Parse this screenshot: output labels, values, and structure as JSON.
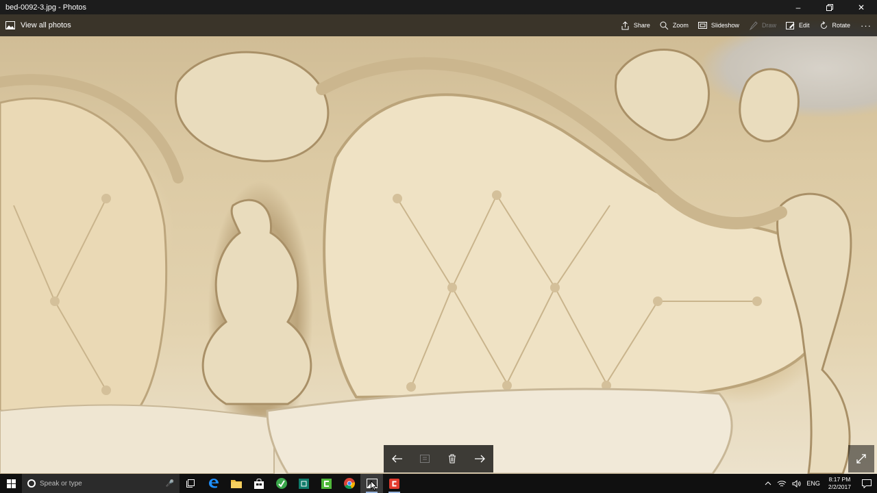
{
  "window": {
    "title": "bed-0092-3.jpg - Photos",
    "minimize_icon": "minimize-icon",
    "maximize_icon": "restore-icon",
    "close_icon": "close-icon"
  },
  "toolbar": {
    "view_all_label": "View all photos",
    "view_all_icon": "photo-icon",
    "items": [
      {
        "label": "Share",
        "icon": "share-icon",
        "enabled": true
      },
      {
        "label": "Zoom",
        "icon": "zoom-icon",
        "enabled": true
      },
      {
        "label": "Slideshow",
        "icon": "slideshow-icon",
        "enabled": true
      },
      {
        "label": "Draw",
        "icon": "draw-icon",
        "enabled": false
      },
      {
        "label": "Edit",
        "icon": "edit-icon",
        "enabled": true
      },
      {
        "label": "Rotate",
        "icon": "rotate-icon",
        "enabled": true
      }
    ],
    "more_label": "···"
  },
  "nav": {
    "previous_icon": "arrow-left-icon",
    "info_icon": "info-icon",
    "delete_icon": "trash-icon",
    "next_icon": "arrow-right-icon",
    "fullscreen_icon": "expand-icon"
  },
  "taskbar": {
    "search_placeholder": "Speak or type",
    "apps": [
      "task-view-icon",
      "edge-icon",
      "file-explorer-icon",
      "store-icon",
      "green-app-icon",
      "teal-app-icon",
      "camtasia-icon",
      "chrome-icon",
      "photos-icon",
      "red-app-icon"
    ],
    "language": "ENG",
    "time": "8:17 PM",
    "date": "2/2/2017"
  },
  "colors": {
    "titlebar": "#1c1c1c",
    "taskbar": "#101010",
    "photo_cream": "#e4d3ae"
  }
}
